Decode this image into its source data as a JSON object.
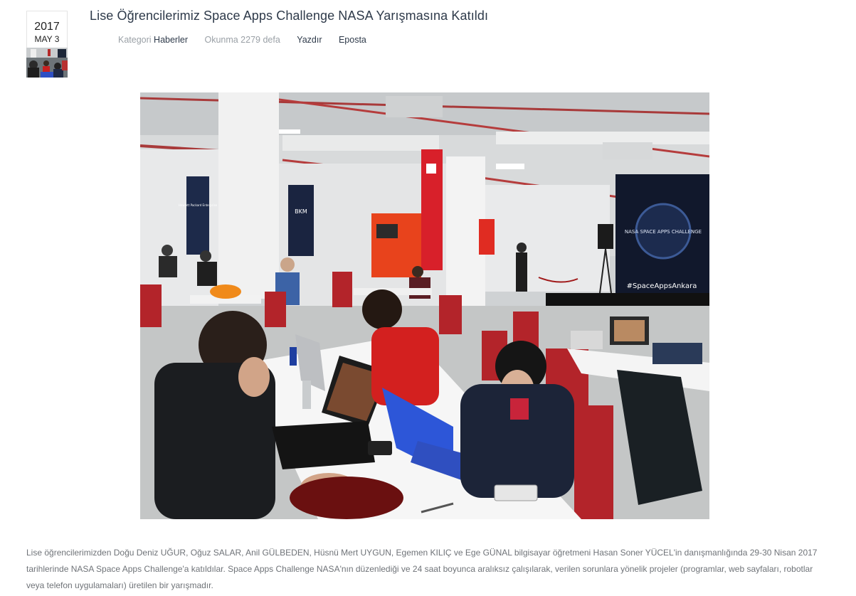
{
  "article": {
    "date": {
      "year": "2017",
      "day": "MAY 3"
    },
    "title": "Lise Öğrencilerimiz Space Apps Challenge NASA Yarışmasına Katıldı",
    "meta": {
      "category_label": "Kategori",
      "category_link": "Haberler",
      "hits": "Okunma 2279 defa",
      "print_label": "Yazdır",
      "email_label": "Eposta"
    },
    "photo": {
      "poster_text": "NASA SPACE APPS CHALLENGE",
      "hashtag_text": "#SpaceAppsAnkara",
      "banner_text": "BKM",
      "banner_text_2": "Hewlett Packard Enterprise"
    },
    "body": "Lise öğrencilerimizden Doğu Deniz UĞUR, Oğuz SALAR, Anil GÜLBEDEN, Hüsnü Mert UYGUN, Egemen KILIÇ ve Ege GÜNAL bilgisayar öğretmeni Hasan Soner YÜCEL'in danışmanlığında 29-30 Nisan 2017 tarihlerinde NASA Space Apps Challenge'a katıldılar. Space Apps Challenge NASA'nın düzenlediği ve 24 saat boyunca aralıksız çalışılarak, verilen sorunlara yönelik projeler (programlar, web sayfaları, robotlar veya telefon uygulamaları) üretilen bir yarışmadır."
  }
}
